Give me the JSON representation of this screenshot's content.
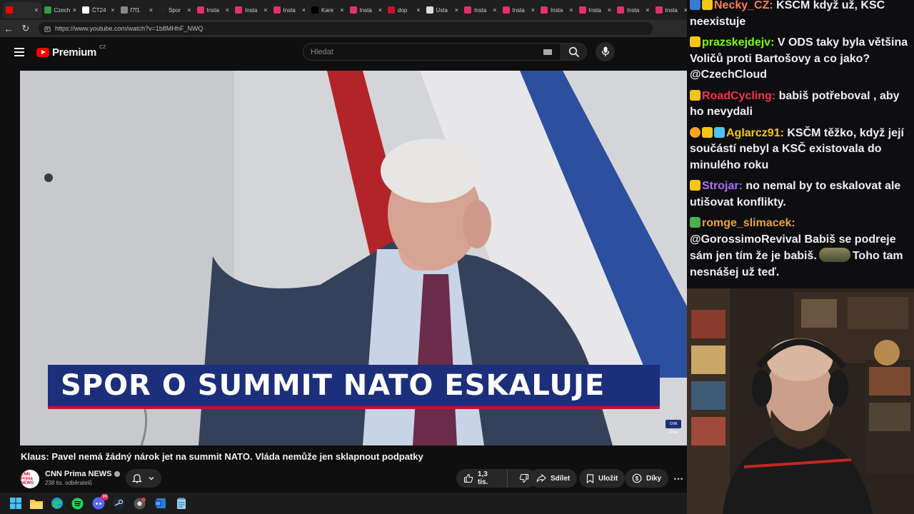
{
  "browser": {
    "tabs": [
      {
        "label": "",
        "fav": "#ff0000",
        "active": true
      },
      {
        "label": "Czech",
        "fav": "#2e9e44"
      },
      {
        "label": "ČT24",
        "fav": "#ffffff"
      },
      {
        "label": "f7f1",
        "fav": "#888888"
      },
      {
        "label": "Spor",
        "fav": "#222222"
      },
      {
        "label": "Insta",
        "fav": "#e1306c"
      },
      {
        "label": "Insta",
        "fav": "#e1306c"
      },
      {
        "label": "Insta",
        "fav": "#e1306c"
      },
      {
        "label": "Kare",
        "fav": "#000000"
      },
      {
        "label": "Insta",
        "fav": "#e1306c"
      },
      {
        "label": "dop",
        "fav": "#c8102e"
      },
      {
        "label": "Ústa",
        "fav": "#dddddd"
      },
      {
        "label": "Insta",
        "fav": "#e1306c"
      },
      {
        "label": "Insta",
        "fav": "#e1306c"
      },
      {
        "label": "Insta",
        "fav": "#e1306c"
      },
      {
        "label": "Insta",
        "fav": "#e1306c"
      },
      {
        "label": "Insta",
        "fav": "#e1306c"
      },
      {
        "label": "Insta",
        "fav": "#e1306c"
      }
    ],
    "url": "https://www.youtube.com/watch?v=1b8MHhF_NWQ"
  },
  "youtube": {
    "logo_text": "Premium",
    "logo_region": "CZ",
    "search_placeholder": "Hledat",
    "lower_third": "SPOR O SUMMIT NATO ESKALUJE",
    "corner_bug": "CNN Prima",
    "video_title": "Klaus: Pavel nemá žádný nárok jet na summit NATO. Vláda nemůže jen sklapnout podpatky",
    "channel": {
      "avatar_text": "CNN Prima NEWS",
      "name": "CNN Prima NEWS",
      "subs": "238 tis. odběratelů"
    },
    "actions": {
      "likes": "1,3 tis.",
      "share": "Sdílet",
      "save": "Uložit",
      "thanks": "Díky"
    }
  },
  "chat": {
    "messages": [
      {
        "badges": [
          "#3a7bd5",
          "#f5c518"
        ],
        "user": "Necky_CZ",
        "color": "#ff7f50",
        "text": "KSČM když už, KSČ neexistuje"
      },
      {
        "badges": [
          "#f5c518"
        ],
        "user": "prazskejdejv",
        "color": "#7cfc00",
        "text": "V ODS taky byla většina Voličů proti Bartošovy a co jako? @CzechCloud"
      },
      {
        "badges": [
          "#f5c518"
        ],
        "user": "RoadCycling",
        "color": "#ff2e4c",
        "text": "babiš potřeboval , aby ho nevydali"
      },
      {
        "badges": [
          "#f5a623",
          "#f5c518",
          "#4fc3f7"
        ],
        "user": "Aglarcz91",
        "color": "#f5c518",
        "text": "KSČM těžko, když její součástí nebyl a KSČ existovala do minulého roku"
      },
      {
        "badges": [
          "#f5c518"
        ],
        "user": "Strojar",
        "color": "#a970ff",
        "text": "no nemal by to eskalovat ale utišovat konflikty."
      },
      {
        "badges": [
          "#4caf50"
        ],
        "user": "romge_slimacek",
        "color": "#e8a33c",
        "text": "@GorossimoRevival Babiš se podreje sám jen tím že je babiš.",
        "emote": "emote",
        "text_after": "Toho tam nesnášej už teď."
      }
    ]
  },
  "taskbar": {
    "icons": [
      "windows-start-icon",
      "file-explorer-icon",
      "edge-browser-icon",
      "spotify-icon",
      "discord-icon",
      "steam-icon",
      "chrome-icon",
      "word-icon",
      "notepad-icon"
    ],
    "discord_badge": "99"
  }
}
